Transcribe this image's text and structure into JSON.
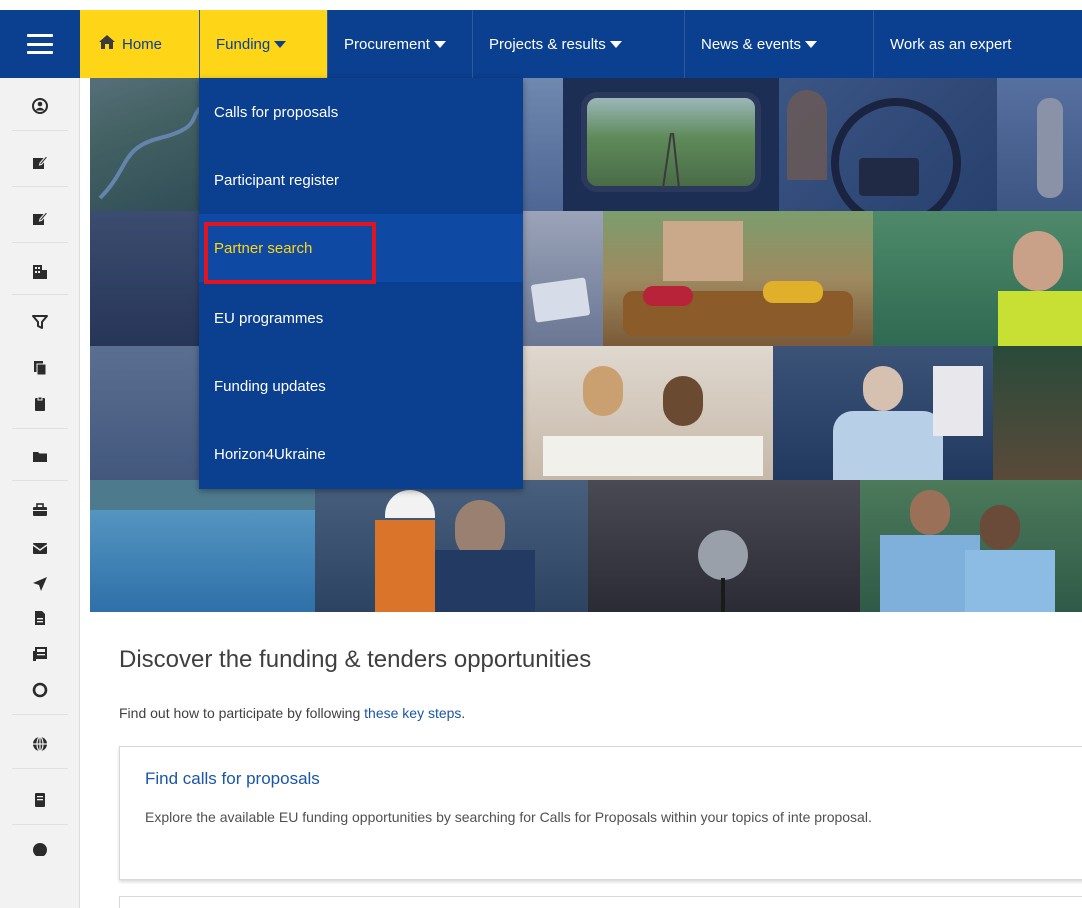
{
  "topnav": {
    "home_label": "Home",
    "funding_label": "Funding",
    "procurement_label": "Procurement",
    "projects_label": "Projects & results",
    "news_label": "News & events",
    "work_label": "Work as an expert"
  },
  "funding_menu": {
    "items": [
      {
        "label": "Calls for proposals"
      },
      {
        "label": "Participant register"
      },
      {
        "label": "Partner search"
      },
      {
        "label": "EU programmes"
      },
      {
        "label": "Funding updates"
      },
      {
        "label": "Horizon4Ukraine"
      }
    ],
    "selected": "Partner search"
  },
  "content": {
    "title": "Discover the funding & tenders opportunities",
    "intro_prefix": "Find out how to participate by following ",
    "intro_link": "these key steps",
    "intro_suffix": ".",
    "card": {
      "title": "Find calls for proposals",
      "description": "Explore the available EU funding opportunities by searching for Calls for Proposals within your topics of inte proposal."
    }
  },
  "colors": {
    "nav_blue": "#0b3f8f",
    "eu_yellow": "#ffd617",
    "link_blue": "#1a56a8",
    "highlight_red": "#e1141f"
  },
  "icons": {
    "menu": "hamburger-icon",
    "home": "home-icon",
    "sidebar": [
      "user-icon",
      "edit-icon",
      "edit-icon",
      "building-icon",
      "funnel-icon",
      "documents-icon",
      "clipboard-icon",
      "folder-icon",
      "briefcase-icon",
      "envelope-icon",
      "paper-plane-icon",
      "file-icon",
      "newspaper-icon",
      "circle-icon",
      "globe-icon",
      "book-icon"
    ]
  }
}
